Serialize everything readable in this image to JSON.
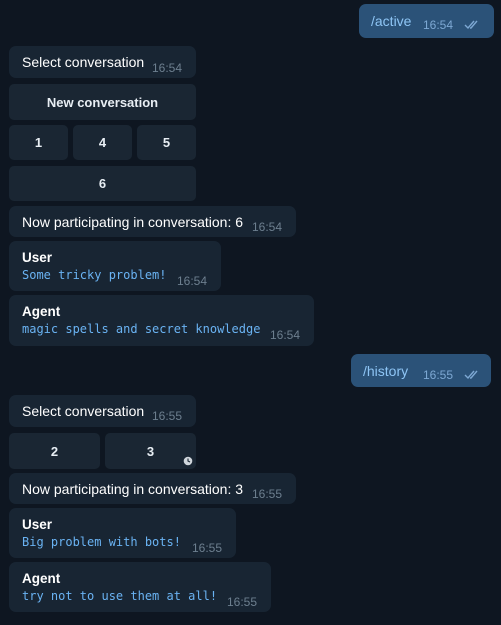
{
  "colors": {
    "background": "#0e1621",
    "incoming_bubble": "#182533",
    "outgoing_bubble": "#2b5278",
    "button": "#1a2633",
    "code": "#6ab3f3"
  },
  "messages": {
    "m1": {
      "text": "/active",
      "time": "16:54"
    },
    "m2": {
      "text": "Select conversation",
      "time": "16:54"
    },
    "kb1": {
      "new": "New conversation",
      "b1": "1",
      "b4": "4",
      "b5": "5",
      "b6": "6"
    },
    "m3": {
      "text": "Now participating in conversation: 6",
      "time": "16:54"
    },
    "m4": {
      "name": "User",
      "text": "Some tricky problem!",
      "time": "16:54"
    },
    "m5": {
      "name": "Agent",
      "text": "magic spells and secret knowledge",
      "time": "16:54"
    },
    "m6": {
      "text": "/history",
      "time": "16:55"
    },
    "m7": {
      "text": "Select conversation",
      "time": "16:55"
    },
    "kb2": {
      "b2": "2",
      "b3": "3"
    },
    "m8": {
      "text": "Now participating in conversation: 3",
      "time": "16:55"
    },
    "m9": {
      "name": "User",
      "text": "Big problem with bots!",
      "time": "16:55"
    },
    "m10": {
      "name": "Agent",
      "text": "try not to use them at all!",
      "time": "16:55"
    }
  },
  "icons": {
    "read": "double-check-icon",
    "pending": "clock-icon"
  }
}
